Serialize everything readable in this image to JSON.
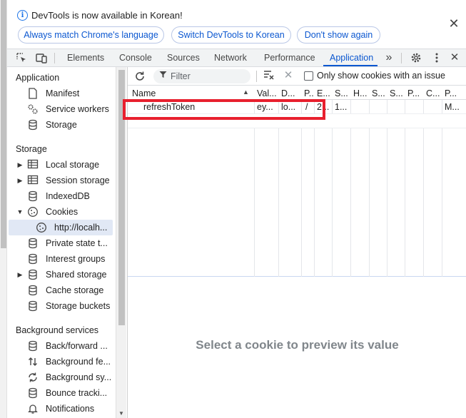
{
  "infobar": {
    "message": "DevTools is now available in Korean!",
    "info_glyph": "i",
    "buttons": [
      "Always match Chrome's language",
      "Switch DevTools to Korean",
      "Don't show again"
    ],
    "close_glyph": "✕"
  },
  "tabstrip": {
    "tabs": [
      "Elements",
      "Console",
      "Sources",
      "Network",
      "Performance",
      "Application"
    ],
    "active_tab": "Application",
    "more_glyph": "»"
  },
  "sidebar": {
    "sections": {
      "application": "Application",
      "storage": "Storage",
      "background": "Background services"
    },
    "application_items": [
      "Manifest",
      "Service workers",
      "Storage"
    ],
    "storage_items": [
      "Local storage",
      "Session storage",
      "IndexedDB",
      "Cookies",
      "http://localh...",
      "Private state t...",
      "Interest groups",
      "Shared storage",
      "Cache storage",
      "Storage buckets"
    ],
    "background_items": [
      "Back/forward ...",
      "Background fe...",
      "Background sy...",
      "Bounce tracki...",
      "Notifications"
    ]
  },
  "toolbar": {
    "filter_placeholder": "Filter",
    "only_issues_label": "Only show cookies with an issue"
  },
  "cookies_table": {
    "columns": [
      "Name",
      "Val...",
      "D...",
      "P...",
      "E...",
      "S...",
      "H...",
      "S...",
      "S...",
      "P...",
      "C...",
      "P..."
    ],
    "rows": [
      [
        "refreshToken",
        "ey...",
        "lo...",
        "/",
        "2...",
        "1...",
        "",
        "",
        "",
        "",
        "",
        "M..."
      ]
    ]
  },
  "preview": {
    "empty_message": "Select a cookie to preview its value"
  },
  "colors": {
    "accent": "#0b57d0",
    "highlight": "#e8202e"
  }
}
